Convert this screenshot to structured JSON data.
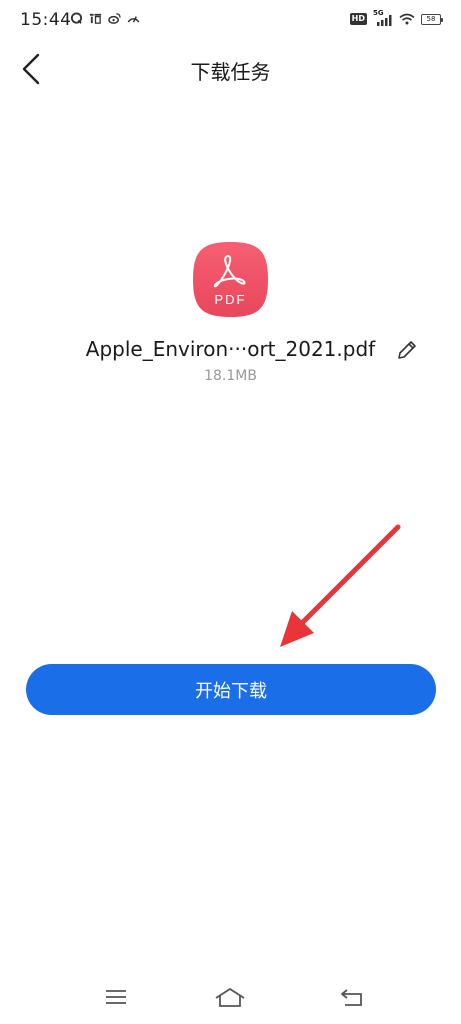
{
  "status_bar": {
    "time": "15:44",
    "network": "5G",
    "hd_label": "HD",
    "battery": "58",
    "left_icons": [
      "qq-icon",
      "taobao-icon",
      "weibo-icon",
      "speed-icon"
    ]
  },
  "header": {
    "title": "下载任务",
    "back_icon": "chevron-left-icon"
  },
  "file": {
    "icon_label": "PDF",
    "name": "Apple_Environ···ort_2021.pdf",
    "size": "18.1MB",
    "edit_icon": "pencil-icon"
  },
  "actions": {
    "start_label": "开始下载"
  },
  "nav": {
    "icons": [
      "menu-icon",
      "home-icon",
      "back-nav-icon"
    ]
  },
  "colors": {
    "primary": "#1a6fe8",
    "pdf_red": "#f04f63",
    "annotation": "#e8353a"
  }
}
